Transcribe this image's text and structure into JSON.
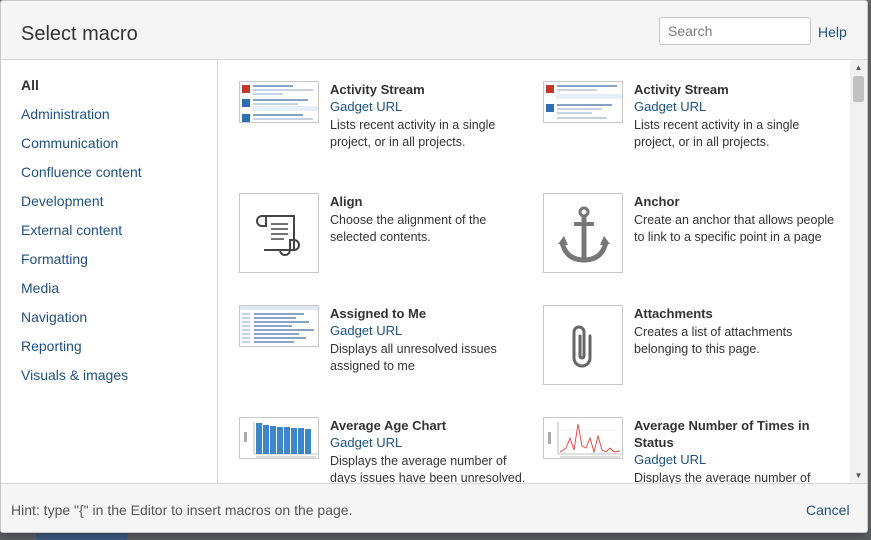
{
  "dialog": {
    "title": "Select macro",
    "search_placeholder": "Search",
    "help_label": "Help"
  },
  "sidebar": {
    "categories": [
      {
        "label": "All",
        "active": true
      },
      {
        "label": "Administration"
      },
      {
        "label": "Communication"
      },
      {
        "label": "Confluence content"
      },
      {
        "label": "Development"
      },
      {
        "label": "External content"
      },
      {
        "label": "Formatting"
      },
      {
        "label": "Media"
      },
      {
        "label": "Navigation"
      },
      {
        "label": "Reporting"
      },
      {
        "label": "Visuals & images"
      }
    ]
  },
  "macros": [
    {
      "title": "Activity Stream",
      "link": "Gadget URL",
      "desc": "Lists recent activity in a single project, or in all projects.",
      "icon": "activity-stream-screenshot"
    },
    {
      "title": "Activity Stream",
      "link": "Gadget URL",
      "desc": "Lists recent activity in a single project, or in all projects.",
      "icon": "activity-stream-screenshot"
    },
    {
      "title": "Align",
      "desc": "Choose the alignment of the selected contents.",
      "icon": "scroll-icon"
    },
    {
      "title": "Anchor",
      "desc": "Create an anchor that allows people to link to a specific point in a page",
      "icon": "anchor-icon"
    },
    {
      "title": "Assigned to Me",
      "link": "Gadget URL",
      "desc": "Displays all unresolved issues assigned to me",
      "icon": "issue-list-screenshot"
    },
    {
      "title": "Attachments",
      "desc": "Creates a list of attachments belonging to this page.",
      "icon": "paperclip-icon"
    },
    {
      "title": "Average Age Chart",
      "link": "Gadget URL",
      "desc": "Displays the average number of days issues have been unresolved.",
      "icon": "bar-chart-screenshot"
    },
    {
      "title": "Average Number of Times in Status",
      "link": "Gadget URL",
      "desc": "Displays the average number of",
      "icon": "line-chart-screenshot"
    }
  ],
  "footer": {
    "hint": "Hint: type \"{\" in the Editor to insert macros on the page.",
    "cancel_label": "Cancel"
  },
  "colors": {
    "link": "#205081",
    "text": "#333333",
    "chart_blue": "#3b87c8",
    "chart_red": "#e8403a"
  }
}
